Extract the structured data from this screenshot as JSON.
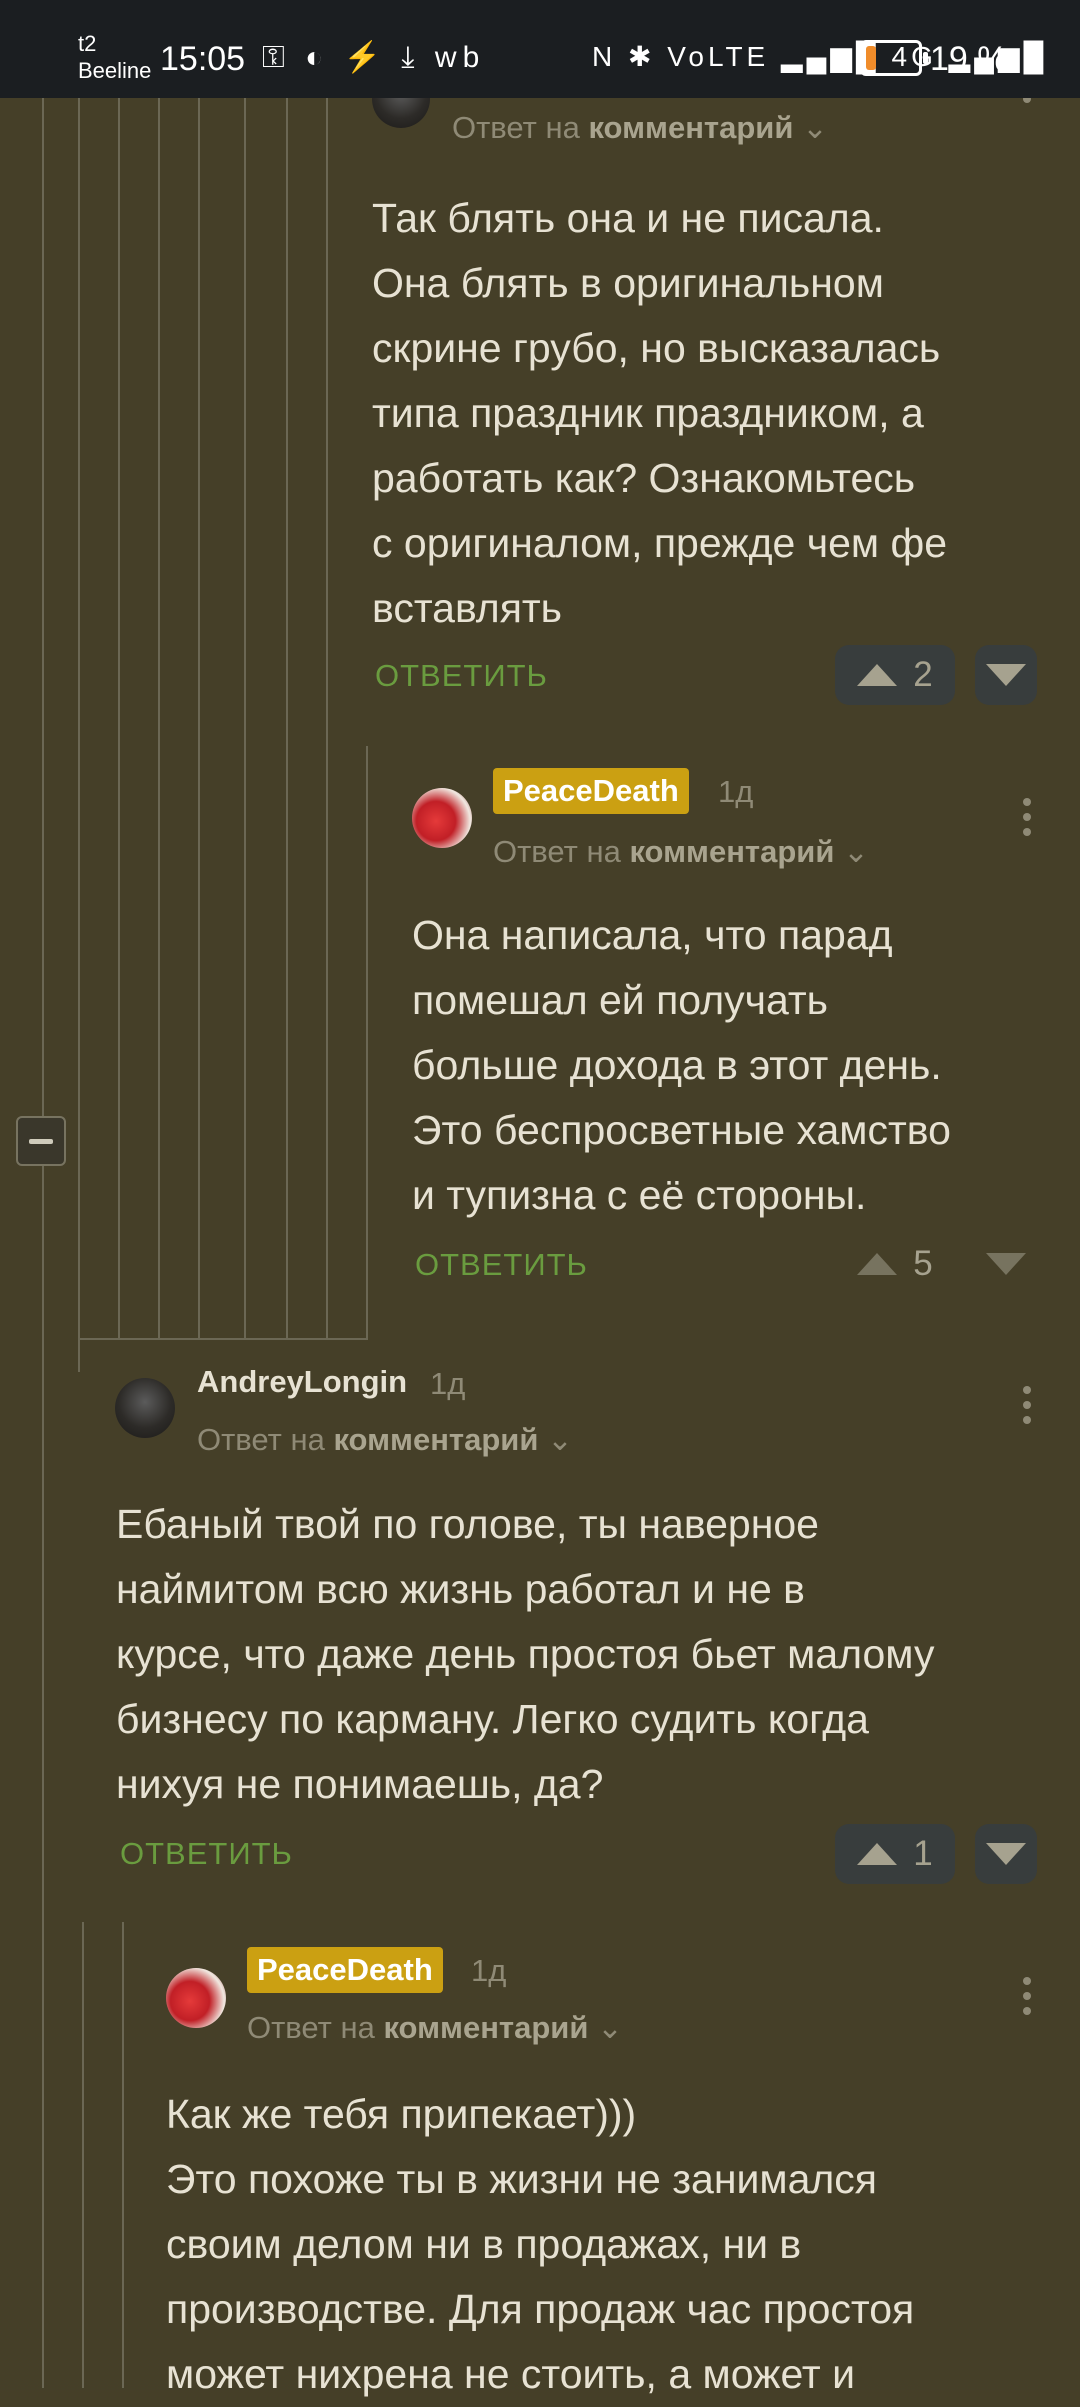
{
  "status_bar": {
    "carrier_top": "t2",
    "carrier_bottom": "Beeline",
    "time": "15:05",
    "icons_left": "⚿ ◐ ⚡ ⤓ wb",
    "icons_right": "N ✱ VoLTE ▂▄▆█ 4G ▂▄▆█",
    "battery_level": 0.19,
    "battery_text": "19 %"
  },
  "comments": [
    {
      "reply_prefix": "Ответ на",
      "reply_target": "комментарий",
      "text": "Так блять она и не писала.\nОна блять в оригинальном\nскрине грубо, но высказалась\nтипа праздник праздником, а\nработать как? Ознакомьтесь\nс оригиналом, прежде чем фе\nвставлять",
      "reply_label": "ОТВЕТИТЬ",
      "votes": "2"
    },
    {
      "author": "PeaceDeath",
      "time": "1д",
      "reply_prefix": "Ответ на",
      "reply_target": "комментарий",
      "text": "Она написала, что парад\nпомешал ей получать\nбольше дохода в этот день.\nЭто беспросветные хамство\nи тупизна с её стороны.",
      "reply_label": "ОТВЕТИТЬ",
      "votes": "5"
    },
    {
      "author": "AndreyLongin",
      "time": "1д",
      "reply_prefix": "Ответ на",
      "reply_target": "комментарий",
      "text": "Ебаный твой по голове, ты наверное\nнаймитом всю жизнь работал и не в\nкурсе, что даже день простоя бьет малому\nбизнесу по карману. Легко судить когда\nнихуя не понимаешь, да?",
      "reply_label": "ОТВЕТИТЬ",
      "votes": "1"
    },
    {
      "author": "PeaceDeath",
      "time": "1д",
      "reply_prefix": "Ответ на",
      "reply_target": "комментарий",
      "text": "Как же тебя припекает)))\nЭто похоже ты в жизни не занимался\nсвоим делом ни в продажах, ни в\nпроизводстве. Для продаж час простоя\nможет нихрена не стоить, а может и"
    }
  ]
}
